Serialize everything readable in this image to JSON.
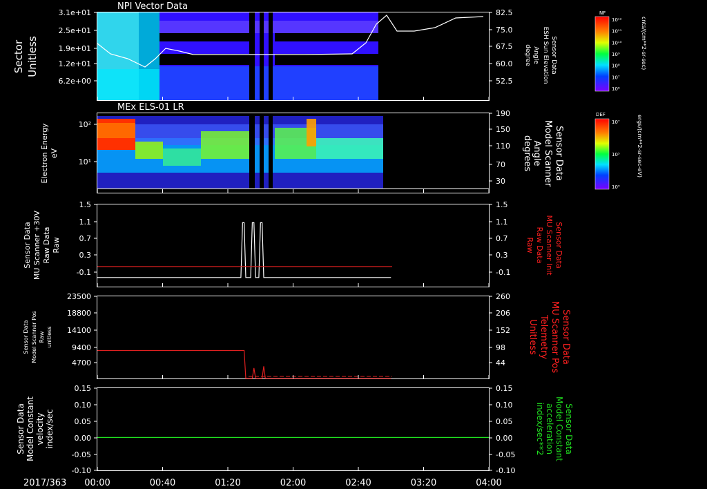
{
  "doy_label": "2017/363",
  "time_ticks": [
    "00:00",
    "00:40",
    "01:20",
    "02:00",
    "02:40",
    "03:20",
    "04:00"
  ],
  "colors": {
    "red": "#ff2020",
    "green": "#20e020",
    "white": "#ffffff"
  },
  "panels": [
    {
      "id": "p1",
      "title": "NPI Vector Data",
      "left_label": [
        "Sector",
        "Unitless"
      ],
      "left_ticks": [
        "3.1e+01",
        "2.5e+01",
        "1.9e+01",
        "1.2e+01",
        "6.2e+00"
      ],
      "right_label": [
        "Sensor Data",
        "ESH Sun Elevation",
        "Angle",
        "degree"
      ],
      "right_ticks": [
        "82.5",
        "75.0",
        "67.5",
        "60.0",
        "52.5"
      ]
    },
    {
      "id": "p2",
      "title": "MEx ELS-01 LR",
      "left_label": [
        "Electron Energy",
        "eV"
      ],
      "left_ticks": [
        "10²",
        "10¹"
      ],
      "right_label": [
        "Sensor Data",
        "Model Scanner",
        "Angle",
        "degrees"
      ],
      "right_ticks": [
        "190",
        "150",
        "110",
        "70",
        "30"
      ]
    },
    {
      "id": "p3",
      "left_label": [
        "Sensor Data",
        "MU Scanner +30V",
        "Raw Data",
        "Raw"
      ],
      "left_ticks": [
        "1.5",
        "1.1",
        "0.7",
        "0.3",
        "-0.1"
      ],
      "right_label": [
        "Sensor Data",
        "MU Scanner Init",
        "Raw Data",
        "Raw"
      ],
      "right_ticks": [
        "1.5",
        "1.1",
        "0.7",
        "0.3",
        "-0.1"
      ]
    },
    {
      "id": "p4",
      "left_label": [
        "Sensor Data",
        "Model Scanner Pos",
        "Raw",
        "unitless"
      ],
      "left_ticks": [
        "23500",
        "18800",
        "14100",
        "9400",
        "4700"
      ],
      "right_label": [
        "Sensor Data",
        "MU Scanner Pos",
        "Telemetry",
        "Unitless"
      ],
      "right_ticks": [
        "260",
        "206",
        "152",
        "98",
        "44"
      ]
    },
    {
      "id": "p5",
      "left_label": [
        "Sensor Data",
        "Model Constant",
        "velocity",
        "index/sec"
      ],
      "left_ticks": [
        "0.15",
        "0.10",
        "0.05",
        "0.00",
        "-0.05",
        "-0.10"
      ],
      "right_label": [
        "Sensor Data",
        "Model Constant",
        "acceleration",
        "index/sec**2"
      ],
      "right_ticks": [
        "0.15",
        "0.10",
        "0.05",
        "0.00",
        "-0.05",
        "-0.10"
      ]
    }
  ],
  "colorbars": [
    {
      "top_label": "NF",
      "ticks": [
        "10¹²",
        "10¹¹",
        "10¹⁰",
        "10⁹",
        "10⁸",
        "10⁷",
        "10⁶"
      ],
      "unit": "cnts/(cm**2-sr-sec)"
    },
    {
      "top_label": "DEF",
      "ticks": [
        "10⁷",
        "10⁵",
        "10³"
      ],
      "unit": "ergs/(cm**2-sr-sec-eV)"
    }
  ],
  "chart_data": [
    {
      "type": "heatmap",
      "title": "NPI Vector Data",
      "x_range": [
        "00:00",
        "04:00"
      ],
      "ylabel": "Sector Unitless",
      "ylim": [
        0,
        31
      ],
      "overlay_line": {
        "ylabel": "Sensor Data ESH Sun Elevation Angle degree",
        "x": [
          0,
          12,
          25,
          40,
          55,
          70,
          90,
          110,
          130,
          150,
          165,
          175,
          182,
          190,
          200,
          215,
          230,
          240
        ],
        "y": [
          68.6,
          66,
          61,
          62,
          66,
          64,
          64,
          64,
          64,
          64,
          65,
          75,
          81,
          77,
          75,
          75,
          79,
          81
        ]
      }
    },
    {
      "type": "heatmap",
      "title": "MEx ELS-01 LR",
      "x_range": [
        "00:00",
        "04:00"
      ],
      "ylabel": "Electron Energy eV",
      "log_scale": true
    },
    {
      "type": "line",
      "ylim": [
        -0.3,
        1.5
      ],
      "series": [
        {
          "values_x": [
            0,
            88,
            89,
            90,
            91,
            94,
            95,
            96,
            97,
            99,
            100,
            101,
            102,
            104,
            105,
            180
          ],
          "values_y": [
            -0.1,
            -0.1,
            1.1,
            1.1,
            -0.1,
            -0.1,
            1.1,
            1.1,
            -0.1,
            -0.1,
            1.1,
            1.1,
            -0.1,
            -0.1,
            -0.1,
            -0.1
          ]
        }
      ]
    },
    {
      "type": "line",
      "ylim": [
        0,
        23500
      ],
      "series": [
        {
          "values_x": [
            0,
            90,
            91,
            95,
            96,
            97,
            101,
            102,
            103,
            180
          ],
          "values_y": [
            8000,
            8000,
            0,
            0,
            3000,
            0,
            0,
            3500,
            0,
            0
          ]
        }
      ]
    },
    {
      "type": "line",
      "ylim": [
        -0.1,
        0.15
      ],
      "series": [
        {
          "values_x": [
            0,
            240
          ],
          "values_y": [
            0,
            0
          ]
        }
      ]
    }
  ]
}
